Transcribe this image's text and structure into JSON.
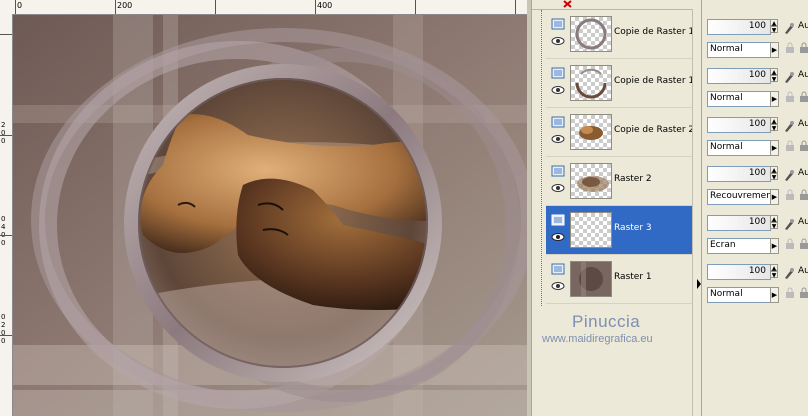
{
  "rulers": {
    "horizontal_labels": [
      "0",
      "200",
      "400"
    ],
    "vertical_labels": [
      "2",
      "0",
      "0",
      "0",
      "4",
      "0",
      "0",
      "0",
      "2",
      "0",
      "0"
    ]
  },
  "layers": [
    {
      "name": "Copie de Raster 1",
      "icon": "raster-layer-icon",
      "thumb": "ring-thin",
      "selected": false
    },
    {
      "name": "Copie de Raster 1",
      "icon": "raster-layer-icon",
      "thumb": "ring-brown",
      "selected": false
    },
    {
      "name": "Copie de Raster 2",
      "icon": "raster-layer-icon",
      "thumb": "faces-small",
      "selected": false
    },
    {
      "name": "Raster 2",
      "icon": "raster-layer-icon",
      "thumb": "faces-fade",
      "selected": false
    },
    {
      "name": "Raster 3",
      "icon": "raster-layer-icon",
      "thumb": "transparent",
      "selected": true
    },
    {
      "name": "Raster 1",
      "icon": "raster-layer-icon",
      "thumb": "background",
      "selected": false
    }
  ],
  "properties": [
    {
      "opacity": "100",
      "blend_mode": "Normal",
      "au": "Au"
    },
    {
      "opacity": "100",
      "blend_mode": "Normal",
      "au": "Au"
    },
    {
      "opacity": "100",
      "blend_mode": "Normal",
      "au": "Au"
    },
    {
      "opacity": "100",
      "blend_mode": "Recouvrement",
      "au": "Au"
    },
    {
      "opacity": "100",
      "blend_mode": "Écran",
      "au": "Au"
    },
    {
      "opacity": "100",
      "blend_mode": "Normal",
      "au": "Au"
    }
  ],
  "watermark": {
    "name": "Pinuccia",
    "url": "www.maidiregrafica.eu"
  },
  "colors": {
    "selection": "#316ac5",
    "panel_bg": "#ece9d8",
    "watermark": "#7e8fb4"
  }
}
